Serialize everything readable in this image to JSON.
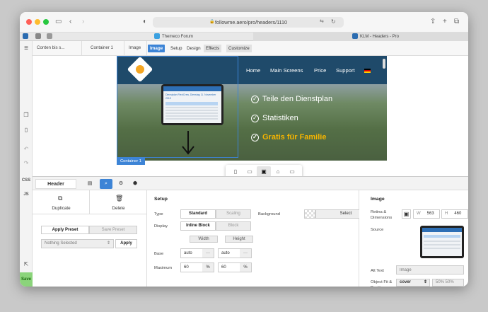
{
  "browser": {
    "url": "followme.aero/pro/headers/1110",
    "tabs": [
      {
        "label": "Themeco Forum"
      },
      {
        "label": "KLM - Headers - Pro"
      }
    ]
  },
  "breadcrumbs": [
    {
      "label": "Conten bis s..."
    },
    {
      "label": "Container 1"
    },
    {
      "label": "Image"
    }
  ],
  "control_tabs": [
    {
      "label": "Image"
    },
    {
      "label": "Setup"
    },
    {
      "label": "Design"
    },
    {
      "label": "Effects"
    },
    {
      "label": "Customize"
    }
  ],
  "leftbar": {
    "css": "CSS",
    "js": "JS",
    "save": "Save"
  },
  "site": {
    "nav": [
      {
        "label": "Home"
      },
      {
        "label": "Main Screens"
      },
      {
        "label": "Price"
      },
      {
        "label": "Support"
      }
    ],
    "features": [
      {
        "label": "Teile den Dienstplan"
      },
      {
        "label": "Statistiken"
      },
      {
        "label": "Gratis für Familie"
      }
    ],
    "selection_label": "Container 1",
    "phone_text": "Dienstplan FlexiCrew, Dienstag 11. November 2019"
  },
  "panel": {
    "header_tab": "Header",
    "duplicate": "Duplicate",
    "delete": "Delete",
    "apply_preset": "Apply Preset",
    "save_preset": "Save Preset",
    "preset_select": "Nothing Selected",
    "apply": "Apply",
    "setup": {
      "title": "Setup",
      "type_label": "Type",
      "type_options": [
        "Standard",
        "Scaling"
      ],
      "display_label": "Display",
      "display_options": [
        "Inline Block",
        "Block"
      ],
      "background_label": "Background",
      "background_select": "Select",
      "width_label": "Width",
      "height_label": "Height",
      "base_label": "Base",
      "base_width": "auto",
      "base_height": "auto",
      "more": "···",
      "maximum_label": "Maximum",
      "max_width": "60",
      "max_height": "60",
      "unit": "%"
    },
    "image": {
      "title": "Image",
      "retina_label": "Retina & Dimensions",
      "w_label": "W",
      "w_value": "563",
      "h_label": "H",
      "h_value": "460",
      "source_label": "Source",
      "alt_label": "Alt Text",
      "alt_placeholder": "Image",
      "fit_label": "Object Fit & Position",
      "fit_value": "cover",
      "position_value": "50% 50%"
    }
  }
}
